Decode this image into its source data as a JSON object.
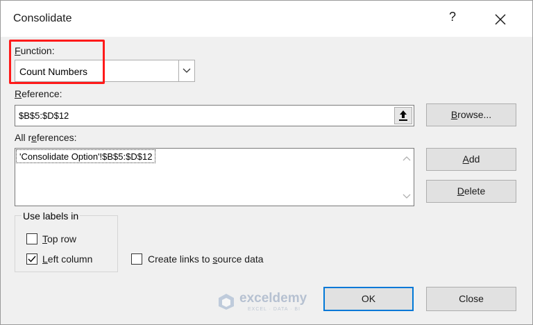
{
  "dialog": {
    "title": "Consolidate",
    "help_label": "?",
    "close_icon": "close-icon"
  },
  "function": {
    "label_accel": "F",
    "label_rest": "unction:",
    "selected": "Count Numbers"
  },
  "reference": {
    "label_accel": "R",
    "label_rest": "eference:",
    "value": "$B$5:$D$12",
    "browse_accel": "B",
    "browse_rest": "rowse..."
  },
  "all_references": {
    "label_pre": "All r",
    "label_accel": "e",
    "label_post": "ferences:",
    "items": [
      "'Consolidate Option'!$B$5:$D$12"
    ],
    "add_accel": "A",
    "add_rest": "dd",
    "delete_accel": "D",
    "delete_rest": "elete"
  },
  "use_labels": {
    "group_title": "Use labels in",
    "top_row_accel": "T",
    "top_row_rest": "op row",
    "top_row_checked": false,
    "left_column_accel": "L",
    "left_column_rest": "eft column",
    "left_column_checked": true
  },
  "create_links": {
    "label_pre": "Create links to ",
    "label_accel": "s",
    "label_post": "ource data",
    "checked": false
  },
  "buttons": {
    "ok": "OK",
    "close": "Close"
  },
  "watermark": {
    "brand": "exceldemy",
    "tagline": "EXCEL · DATA · BI"
  },
  "colors": {
    "highlight": "#ff1a1a",
    "focus": "#0078d7"
  }
}
